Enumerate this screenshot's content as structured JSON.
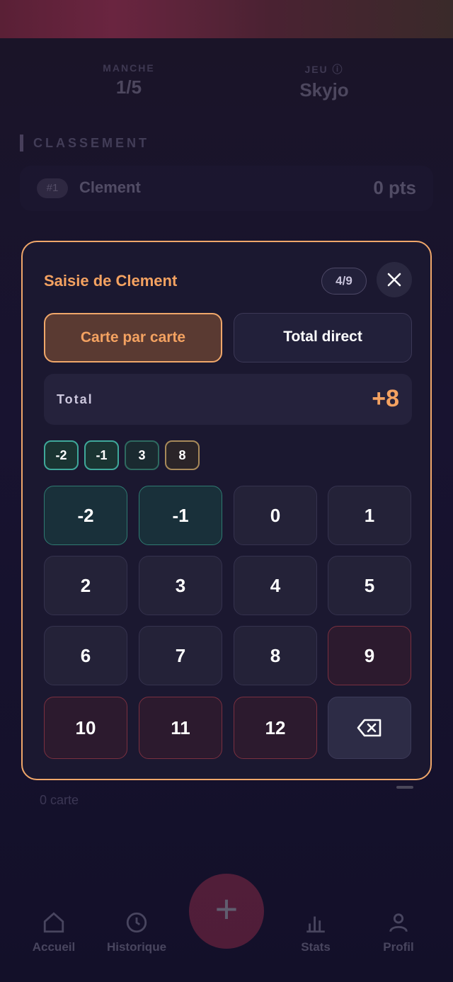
{
  "game": {
    "round_label": "MANCHE",
    "round_value": "1/5",
    "game_label": "JEU ⓘ",
    "game_value": "Skyjo"
  },
  "ranking": {
    "title": "CLASSEMENT",
    "rows": [
      {
        "rank": "#1",
        "name": "Clement",
        "points": "0 pts"
      }
    ]
  },
  "under_card": {
    "subtitle": "0 carte"
  },
  "nav": {
    "items": [
      {
        "label": "Accueil",
        "icon": "home-icon"
      },
      {
        "label": "Historique",
        "icon": "history-icon"
      },
      {
        "label": "Stats",
        "icon": "chart-icon"
      },
      {
        "label": "Profil",
        "icon": "user-icon"
      }
    ],
    "fab_label": "+"
  },
  "modal": {
    "title": "Saisie de Clement",
    "counter": "4/9",
    "tabs": [
      {
        "label": "Carte par carte",
        "active": true
      },
      {
        "label": "Total direct",
        "active": false
      }
    ],
    "total_label": "Total",
    "total_value": "+8",
    "chips": [
      "-2",
      "-1",
      "3",
      "8"
    ],
    "keys": [
      "-2",
      "-1",
      "0",
      "1",
      "2",
      "3",
      "4",
      "5",
      "6",
      "7",
      "8",
      "9",
      "10",
      "11",
      "12"
    ],
    "backspace_icon": "backspace-icon"
  },
  "colors": {
    "accent": "#f4a261",
    "danger": "#d23a5a",
    "teal": "#3fa89a",
    "background": "#16122a"
  }
}
